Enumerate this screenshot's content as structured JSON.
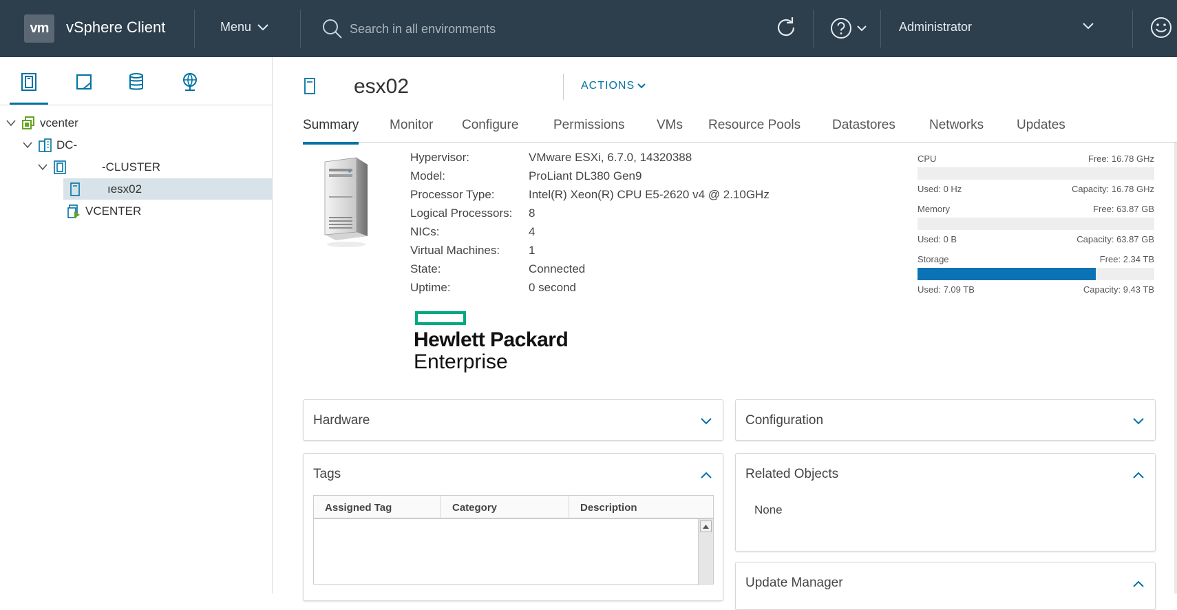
{
  "header": {
    "logo": "vm",
    "app_title": "vSphere Client",
    "menu_label": "Menu",
    "search_placeholder": "Search in all environments",
    "user": "Administrator"
  },
  "nav": {
    "tree": [
      {
        "label": "vcenter"
      },
      {
        "label": "DC-"
      },
      {
        "label": "-CLUSTER"
      },
      {
        "label": "ıesx02"
      },
      {
        "label": "VCENTER"
      }
    ]
  },
  "object": {
    "name": "esx02",
    "actions_label": "ACTIONS"
  },
  "tabs": [
    "Summary",
    "Monitor",
    "Configure",
    "Permissions",
    "VMs",
    "Resource Pools",
    "Datastores",
    "Networks",
    "Updates"
  ],
  "summary": {
    "properties": [
      {
        "label": "Hypervisor:",
        "value": "VMware ESXi, 6.7.0, 14320388"
      },
      {
        "label": "Model:",
        "value": "ProLiant DL380 Gen9"
      },
      {
        "label": "Processor Type:",
        "value": "Intel(R) Xeon(R) CPU E5-2620 v4 @ 2.10GHz"
      },
      {
        "label": "Logical Processors:",
        "value": "8"
      },
      {
        "label": "NICs:",
        "value": "4"
      },
      {
        "label": "Virtual Machines:",
        "value": "1"
      },
      {
        "label": "State:",
        "value": "Connected"
      },
      {
        "label": "Uptime:",
        "value": "0 second"
      }
    ],
    "vendor_logo": {
      "line1": "Hewlett Packard",
      "line2": "Enterprise",
      "accent": "#01a982"
    },
    "meters": [
      {
        "name": "CPU",
        "free": "Free: 16.78 GHz",
        "used": "Used: 0 Hz",
        "capacity": "Capacity: 16.78 GHz",
        "used_fraction": 0
      },
      {
        "name": "Memory",
        "free": "Free: 63.87 GB",
        "used": "Used: 0 B",
        "capacity": "Capacity: 63.87 GB",
        "used_fraction": 0
      },
      {
        "name": "Storage",
        "free": "Free: 2.34 TB",
        "used": "Used: 7.09 TB",
        "capacity": "Capacity: 9.43 TB",
        "used_fraction": 0.752
      }
    ]
  },
  "panels": {
    "hardware": "Hardware",
    "configuration": "Configuration",
    "tags": "Tags",
    "tag_columns": [
      "Assigned Tag",
      "Category",
      "Description"
    ],
    "related_objects": "Related Objects",
    "related_value": "None",
    "update_manager": "Update Manager"
  },
  "colors": {
    "header_bg": "#2d3e4c",
    "accent": "#0072a3",
    "meter_fill": "#0b72b5",
    "selected_row": "#d8e3e9"
  }
}
